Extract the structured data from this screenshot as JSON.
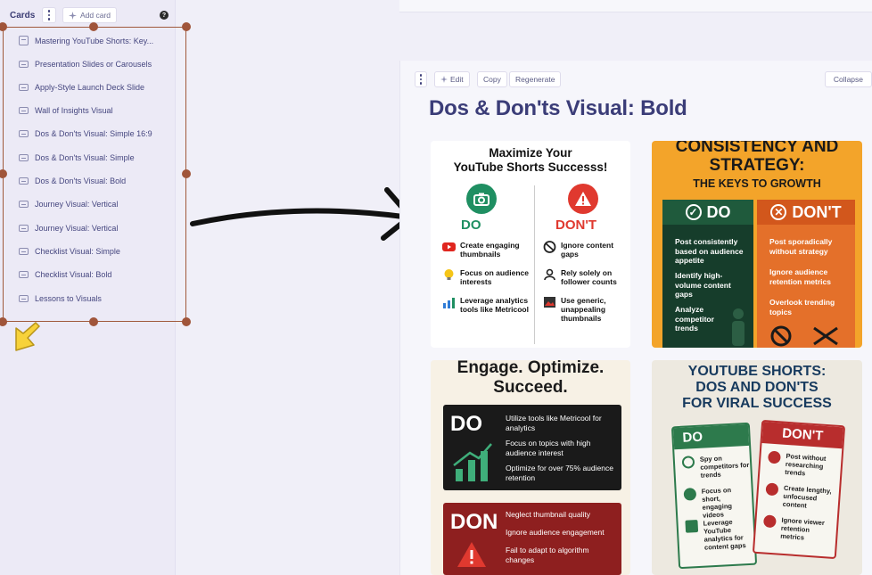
{
  "sidebar": {
    "title": "Cards",
    "add_card_label": "Add card",
    "help_label": "?",
    "items": [
      {
        "label": "Mastering YouTube Shorts: Key..."
      },
      {
        "label": "Presentation Slides or Carousels"
      },
      {
        "label": "Apply-Style Launch Deck Slide"
      },
      {
        "label": "Wall of Insights Visual"
      },
      {
        "label": "Dos & Don'ts Visual: Simple 16:9"
      },
      {
        "label": "Dos & Don'ts Visual: Simple"
      },
      {
        "label": "Dos & Don'ts Visual: Bold"
      },
      {
        "label": "Journey Visual: Vertical"
      },
      {
        "label": "Journey Visual: Vertical"
      },
      {
        "label": "Checklist Visual: Simple"
      },
      {
        "label": "Checklist Visual: Bold"
      },
      {
        "label": "Lessons to Visuals"
      }
    ]
  },
  "toolbar": {
    "edit_label": "Edit",
    "copy_label": "Copy",
    "regenerate_label": "Regenerate",
    "collapse_label": "Collapse"
  },
  "card": {
    "title": "Dos & Don'ts Visual: Bold"
  },
  "images": {
    "img1": {
      "title_line1": "Maximize Your",
      "title_line2": "YouTube Shorts Successs!",
      "do_label": "DO",
      "dont_label": "DON'T",
      "do_items": [
        "Create engaging thumbnails",
        "Focus on audience interests",
        "Leverage analytics tools like Metricool"
      ],
      "dont_items": [
        "Ignore content gaps",
        "Rely solely on follower counts",
        "Use generic, unappealing thumbnails"
      ]
    },
    "img2": {
      "title_line1": "CONSISTENCY AND",
      "title_line2": "STRATEGY:",
      "subtitle": "THE KEYS TO GROWTH",
      "do_label": "DO",
      "dont_label": "DON'T",
      "do_items": [
        "Post consistently based on audience appetite",
        "Identify high-volume content gaps",
        "Analyze competitor trends"
      ],
      "dont_items": [
        "Post sporadically without strategy",
        "Ignore audience retention metrics",
        "Overlook trending topics"
      ]
    },
    "img3": {
      "title_line1": "Engage. Optimize.",
      "title_line2": "Succeed.",
      "do_label": "DO",
      "dont_label": "DON",
      "do_items": [
        "Utilize tools like Metricool for analytics",
        "Focus on topics with high audience interest",
        "Optimize for over 75% audience retention"
      ],
      "dont_items": [
        "Neglect thumbnail quality",
        "Ignore audience engagement",
        "Fail to adapt to algorithm changes"
      ]
    },
    "img4": {
      "title_line1": "YOUTUBE SHORTS:",
      "title_line2": "DOS AND DON'TS",
      "title_line3": "FOR VIRAL SUCCESS",
      "do_label": "DO",
      "dont_label": "DON'T",
      "do_items": [
        "Spy on competitors for trends",
        "Focus on short, engaging videos",
        "Leverage YouTube analytics for content gaps"
      ],
      "dont_items": [
        "Post without researching trends",
        "Create lengthy, unfocused content",
        "Ignore viewer retention metrics"
      ]
    }
  },
  "colors": {
    "selection": "#a05a3c",
    "title": "#3b3d78",
    "do_green": "#1f8f62",
    "dont_red": "#e0392f",
    "accent_orange": "#f3a42a"
  }
}
